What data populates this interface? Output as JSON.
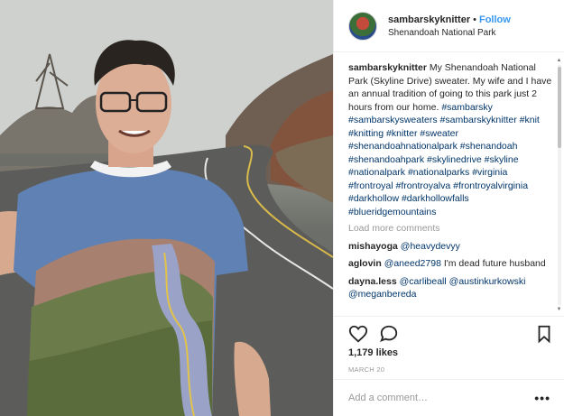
{
  "header": {
    "username": "sambarskyknitter",
    "separator": "•",
    "follow_label": "Follow",
    "location": "Shenandoah National Park"
  },
  "caption": {
    "username": "sambarskyknitter",
    "text": "My Shenandoah National Park (Skyline Drive) sweater. My wife and I have an annual tradition of going to this park just 2 hours from our home.",
    "hashtags": [
      "#sambarsky",
      "#sambarskysweaters",
      "#sambarskyknitter",
      "#knit",
      "#knitting",
      "#knitter",
      "#sweater",
      "#shenandoahnationalpark",
      "#shenandoah",
      "#shenandoahpark",
      "#skylinedrive",
      "#skyline",
      "#nationalpark",
      "#nationalparks",
      "#virginia",
      "#frontroyal",
      "#frontroyalva",
      "#frontroyalvirginia",
      "#darkhollow",
      "#darkhollowfalls",
      "#blueridgemountains"
    ]
  },
  "load_more_label": "Load more comments",
  "comments": [
    {
      "username": "mishayoga",
      "mention": "@heavydevyy",
      "text": ""
    },
    {
      "username": "aglovin",
      "mention": "@aneed2798",
      "text": " I'm dead future husband"
    },
    {
      "username": "dayna.less",
      "mention": "@carlibeall",
      "mention2": "@austinkurkowski",
      "mention3": "@meganbereda",
      "text": ""
    }
  ],
  "actions": {
    "like_icon": "heart-icon",
    "comment_icon": "speech-bubble-icon",
    "save_icon": "bookmark-icon"
  },
  "likes": "1,179 likes",
  "date": "MARCH 20",
  "add_comment": {
    "placeholder": "Add a comment…",
    "more_label": "•••"
  },
  "colors": {
    "link": "#003569",
    "follow": "#3897f0",
    "muted": "#999999"
  }
}
